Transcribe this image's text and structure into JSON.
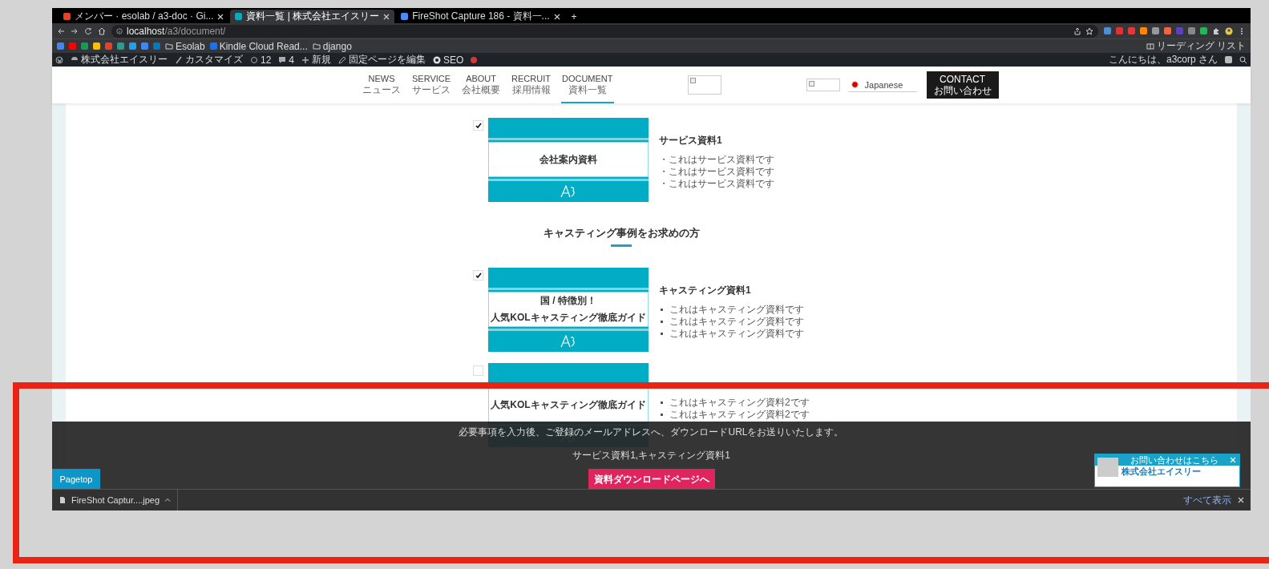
{
  "browser": {
    "tabs": [
      {
        "title": "メンバー · esolab / a3-doc · Gi...",
        "selected": false
      },
      {
        "title": "資料一覧 | 株式会社エイスリー",
        "selected": true
      },
      {
        "title": "FireShot Capture 186 - 資料一...",
        "selected": false
      }
    ],
    "new_tab": "+",
    "url_host": "localhost",
    "url_path": "/a3/document/",
    "bookmarks": [
      "Esolab",
      "Kindle Cloud Read...",
      "django"
    ],
    "reading_list": "リーディング リスト"
  },
  "admin_bar": {
    "site": "株式会社エイスリー",
    "customize": "カスタマイズ",
    "updates": "12",
    "comments": "4",
    "new": "新規",
    "edit": "固定ページを編集",
    "seo": "SEO",
    "greeting": "こんにちは、a3corp さん"
  },
  "header": {
    "nav": [
      {
        "label": "NEWS",
        "sub": "ニュース",
        "selected": false
      },
      {
        "label": "SERVICE",
        "sub": "サービス",
        "selected": false
      },
      {
        "label": "ABOUT",
        "sub": "会社概要",
        "selected": false
      },
      {
        "label": "RECRUIT",
        "sub": "採用情報",
        "selected": false
      },
      {
        "label": "DOCUMENT",
        "sub": "資料一覧",
        "selected": true
      }
    ],
    "language": "Japanese",
    "contact": {
      "label": "CONTACT",
      "sub": "お問い合わせ"
    }
  },
  "content": [
    {
      "kind": "doc",
      "checked": true,
      "thumb_lines": [
        "会社案内資料"
      ],
      "title": "サービス資料1",
      "disc_bullets": false,
      "points": [
        "・これはサービス資料です",
        "・これはサービス資料です",
        "・これはサービス資料です"
      ]
    },
    {
      "kind": "heading",
      "text": "キャスティング事例をお求めの方"
    },
    {
      "kind": "doc",
      "checked": true,
      "thumb_lines": [
        "国 / 特徴別！",
        "人気KOLキャスティング徹底ガイド"
      ],
      "title": "キャスティング資料1",
      "disc_bullets": true,
      "points": [
        "これはキャスティング資料です",
        "これはキャスティング資料です",
        "これはキャスティング資料です"
      ]
    },
    {
      "kind": "doc",
      "checked": false,
      "thumb_lines": [
        "人気KOLキャスティング徹底ガイド"
      ],
      "disc_bullets": true,
      "points": [
        "これはキャスティング資料2です",
        "これはキャスティング資料2です"
      ]
    }
  ],
  "download_panel": {
    "message": "必要事項を入力後、ご登録のメールアドレスへ、ダウンロードURLをお送りいたします。",
    "selection": "サービス資料1,キャスティング資料1",
    "button": "資料ダウンロードページへ"
  },
  "pagetop": "Pagetop",
  "chat": {
    "title": "お問い合わせはこちら",
    "company": "株式会社エイスリー"
  },
  "downloads": {
    "file": "FireShot Captur....jpeg",
    "show_all": "すべて表示"
  }
}
